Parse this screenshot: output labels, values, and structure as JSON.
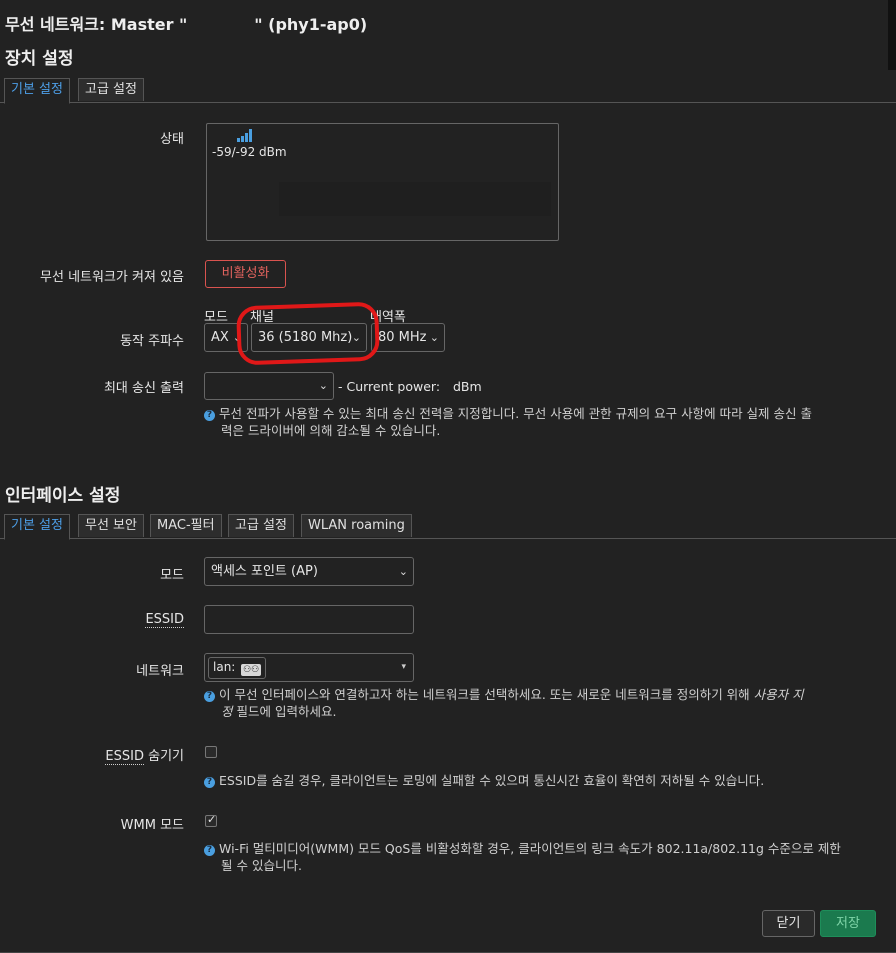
{
  "dialog": {
    "title": "무선 네트워크: Master \"            \" (phy1-ap0)"
  },
  "device": {
    "heading": "장치 설정",
    "tabs": [
      "기본 설정",
      "고급 설정"
    ],
    "status_label": "상태",
    "signal": "-59/-92 dBm",
    "enabled_label": "무선 네트워크가 켜져 있음",
    "disable_button": "비활성화",
    "freq_label": "동작 주파수",
    "mode_header": "모드",
    "channel_header": "채널",
    "width_header": "대역폭",
    "mode_value": "AX",
    "channel_value": "36 (5180 Mhz)",
    "width_value": "80 MHz",
    "txpower_label": "최대 송신 출력",
    "txpower_value": "",
    "current_power": "- Current power:",
    "current_power_unit": "dBm",
    "txpower_help_1": "무선 전파가 사용할 수 있는 최대 송신 전력을 지정합니다. 무선 사용에 관한 규제의 요구 사항에 따라 실제 송신 출",
    "txpower_help_2": "력은 드라이버에 의해 감소될 수 있습니다."
  },
  "iface": {
    "heading": "인터페이스 설정",
    "tabs": [
      "기본 설정",
      "무선 보안",
      "MAC-필터",
      "고급 설정",
      "WLAN roaming"
    ],
    "mode_label": "모드",
    "mode_value": "액세스 포인트 (AP)",
    "essid_label": "ESSID",
    "essid_value": "",
    "network_label": "네트워크",
    "network_value": "lan:",
    "network_help_1a": "이 무선 인터페이스와 연결하고자 하는 네트워크를 선택하세요. 또는 새로운 네트워크를 정의하기 위해 ",
    "network_help_1b": "사용자 지",
    "network_help_2a": "정",
    "network_help_2b": " 필드에 입력하세요.",
    "hide_essid_label_a": "ESSID",
    "hide_essid_label_b": " 숨기기",
    "hide_essid_help": "ESSID를 숨길 경우, 클라이언트는 로밍에 실패할 수 있으며 통신시간 효율이 확연히 저하될 수 있습니다.",
    "wmm_label": "WMM 모드",
    "wmm_help_1": "Wi-Fi 멀티미디어(WMM) 모드 QoS를 비활성화할 경우, 클라이언트의 링크 속도가 802.11a/802.11g 수준으로 제한",
    "wmm_help_2": "될 수 있습니다."
  },
  "footer": {
    "close_button": "닫기",
    "save_button": "저장"
  },
  "colors": {
    "background": "#222222",
    "accent": "#4d9fe8",
    "danger": "#d9534f",
    "success": "#1b7a4e",
    "annotation": "#e01818"
  }
}
